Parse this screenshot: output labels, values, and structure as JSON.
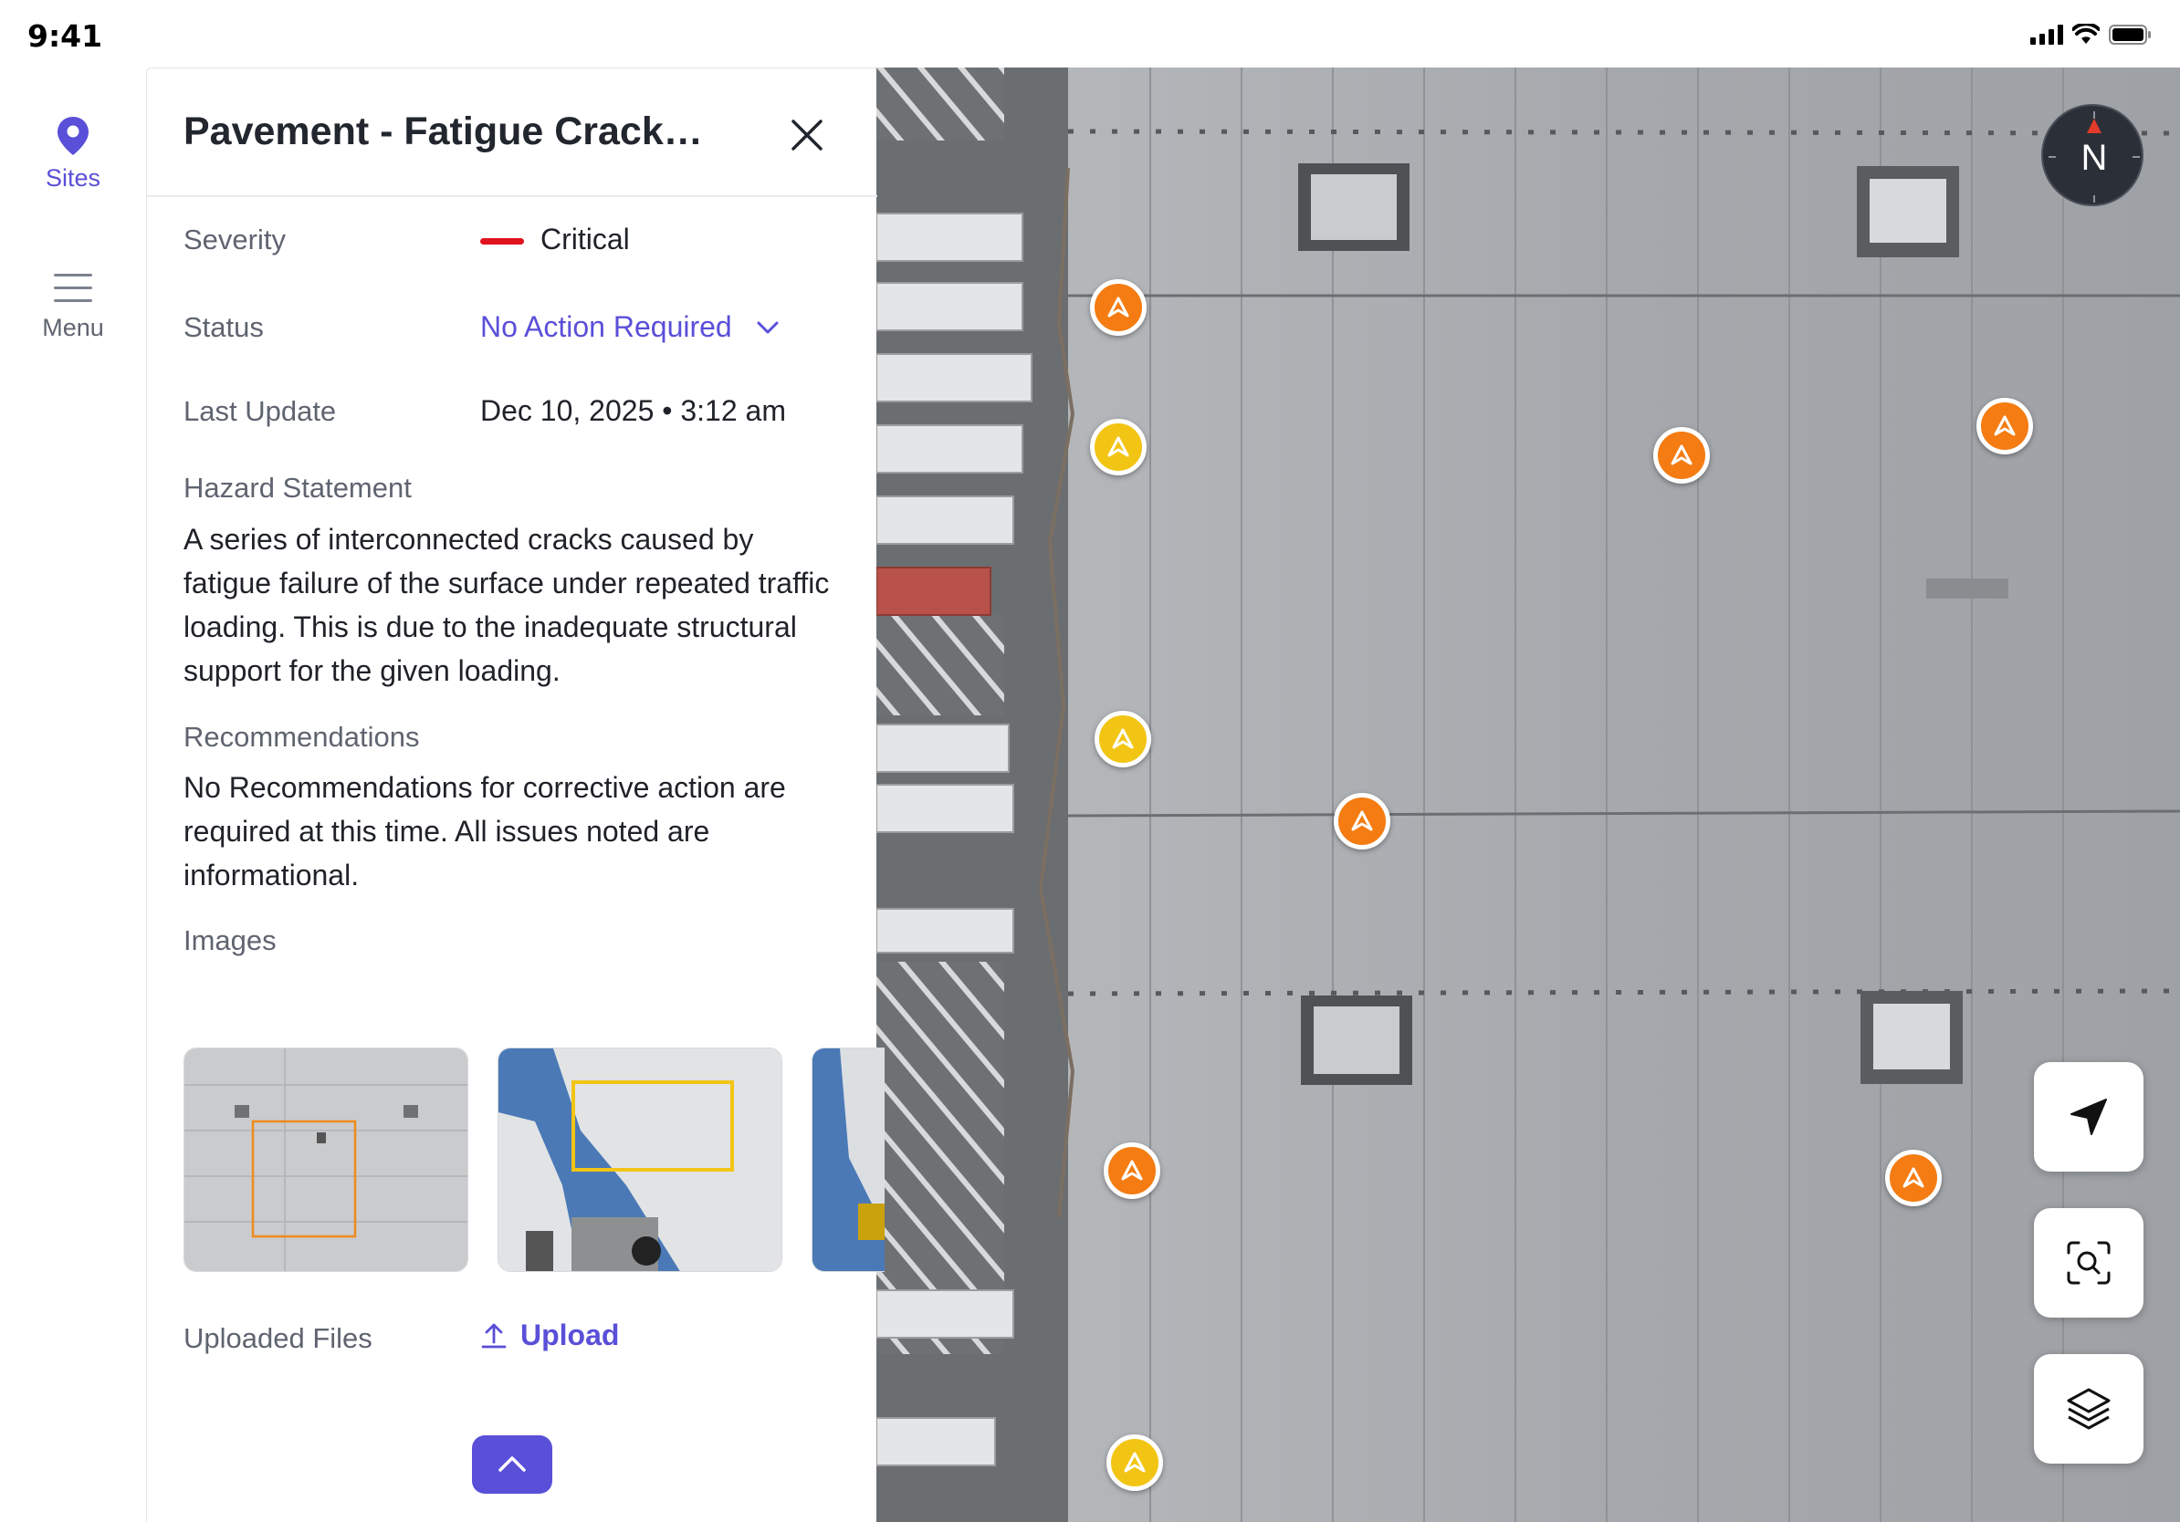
{
  "status_bar": {
    "time": "9:41"
  },
  "nav": {
    "items": [
      {
        "label": "Sites",
        "icon": "location-pin-icon",
        "active": true
      },
      {
        "label": "Menu",
        "icon": "hamburger-icon",
        "active": false
      }
    ]
  },
  "panel": {
    "title": "Pavement - Fatigue Cracking",
    "severity": {
      "label": "Severity",
      "value": "Critical",
      "color": "#e0121f"
    },
    "status": {
      "label": "Status",
      "value": "No Action Required"
    },
    "last_update": {
      "label": "Last Update",
      "value": "Dec 10, 2025 • 3:12 am"
    },
    "hazard": {
      "label": "Hazard Statement",
      "text": "A series of interconnected cracks caused by fatigue failure of the surface under repeated traffic loading.  This is due to the inadequate structural support for the given loading."
    },
    "recommendations": {
      "label": "Recommendations",
      "text": "No Recommendations for corrective action are required at this time.  All issues noted are informational."
    },
    "images": {
      "label": "Images"
    },
    "uploaded_files": {
      "label": "Uploaded Files",
      "action": "Upload"
    }
  },
  "map": {
    "compass_label": "N",
    "markers": [
      {
        "color": "orange"
      },
      {
        "color": "yellow"
      },
      {
        "color": "orange"
      },
      {
        "color": "orange"
      },
      {
        "color": "yellow"
      },
      {
        "color": "orange"
      },
      {
        "color": "orange"
      },
      {
        "color": "orange"
      },
      {
        "color": "yellow"
      }
    ],
    "controls": [
      "navigate-icon",
      "scan-search-icon",
      "layers-icon"
    ]
  },
  "colors": {
    "accent": "#5a4fd8",
    "critical": "#e0121f",
    "marker_orange": "#f47c12",
    "marker_yellow": "#f2c515"
  }
}
